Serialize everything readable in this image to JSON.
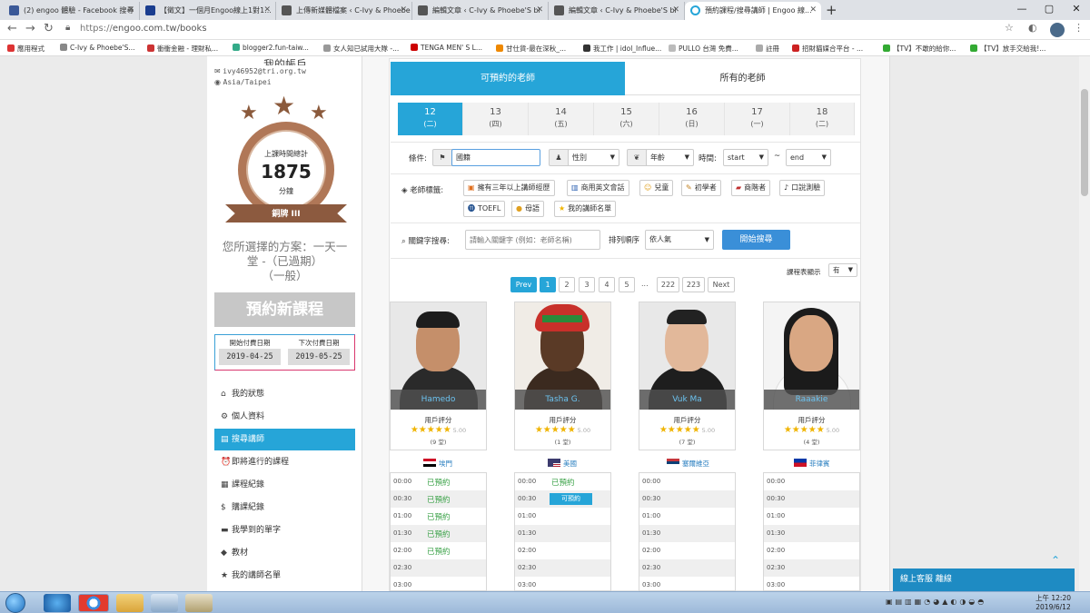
{
  "browser": {
    "tabs": [
      {
        "title": "(2) engoo 體驗 - Facebook 搜尋",
        "fav": "#3b5998"
      },
      {
        "title": "【徵文】一個月Engoo線上1對1...",
        "fav": "#1a3d8f"
      },
      {
        "title": "上傳新媒體檔案 ‹ C-Ivy & Phoebe",
        "fav": "#555"
      },
      {
        "title": "編輯文章 ‹ C-Ivy & Phoebe'S bl",
        "fav": "#555"
      },
      {
        "title": "編輯文章 ‹ C-Ivy & Phoebe'S bl",
        "fav": "#555"
      },
      {
        "title": "預約課程/搜尋講師 | Engoo 線...",
        "fav": "#26a5d8"
      }
    ],
    "new_tab": "+",
    "window_controls": [
      "—",
      "▢",
      "✕"
    ],
    "url_scheme": "https://",
    "url_rest": "engoo.com.tw/books",
    "bookmarks": [
      "應用程式",
      "C-Ivy & Phoebe'S...",
      "衝衝金融 - 理財私...",
      "blogger2.fun-taiw...",
      "女人知已試用大隊 -...",
      "TENGA MEN' S L...",
      "甘仕貨-最在深秋_...",
      "我工作 | idol_Influe...",
      "PULLO 台灣 免費...",
      "註冊",
      "招財貓媒合平台 - ...",
      "【TV】不敢的給你...",
      "【TV】放手交給我!..."
    ]
  },
  "sidebar": {
    "account_title": "我的帳戶",
    "email": "ivy46952@tri.org.tw",
    "timezone": "Asia/Taipei",
    "badge": {
      "title": "上課時間總計",
      "minutes": "1875",
      "unit": "分鐘",
      "rank": "銅牌 III"
    },
    "plan": [
      "您所選擇的方案：一天一",
      "堂 -（已過期）",
      "（一般）"
    ],
    "book_button": "預約新課程",
    "payment": {
      "start_label": "開始付費日期",
      "start_date": "2019-04-25",
      "next_label": "下次付費日期",
      "next_date": "2019-05-25"
    },
    "menu": [
      {
        "icon": "home-icon",
        "glyph": "⌂",
        "label": "我的狀態"
      },
      {
        "icon": "gear-icon",
        "glyph": "⚙",
        "label": "個人資料"
      },
      {
        "icon": "book-icon",
        "glyph": "▤",
        "label": "搜尋講師"
      },
      {
        "icon": "clock-icon",
        "glyph": "⏰",
        "label": "即將進行的課程"
      },
      {
        "icon": "list-icon",
        "glyph": "▦",
        "label": "課程紀錄"
      },
      {
        "icon": "dollar-icon",
        "glyph": "$",
        "label": "購課紀錄"
      },
      {
        "icon": "folder-icon",
        "glyph": "▬",
        "label": "我學到的單字"
      },
      {
        "icon": "tag-icon",
        "glyph": "◆",
        "label": "教材"
      },
      {
        "icon": "star-icon",
        "glyph": "★",
        "label": "我的講師名單"
      }
    ]
  },
  "main": {
    "tab_available": "可預約的老師",
    "tab_all": "所有的老師",
    "dates": [
      {
        "day": "12",
        "weekday": "(二)"
      },
      {
        "day": "13",
        "weekday": "(四)"
      },
      {
        "day": "14",
        "weekday": "(五)"
      },
      {
        "day": "15",
        "weekday": "(六)"
      },
      {
        "day": "16",
        "weekday": "(日)"
      },
      {
        "day": "17",
        "weekday": "(一)"
      },
      {
        "day": "18",
        "weekday": "(二)"
      }
    ],
    "filters": {
      "condition_label": "條件:",
      "nationality_value": "國籍",
      "gender_value": "性別",
      "age_value": "年齡",
      "time_label": "時間:",
      "time_start": "start",
      "time_sep": "~",
      "time_end": "end",
      "tags_label": "老師標籤:",
      "tags": [
        {
          "glyph": "▣",
          "label": "擁有三年以上講師經歷"
        },
        {
          "glyph": "▥",
          "label": "商用英文會話"
        },
        {
          "glyph": "☺",
          "label": "兒童"
        },
        {
          "glyph": "✎",
          "label": "初學者"
        },
        {
          "glyph": "▰",
          "label": "商階者"
        },
        {
          "glyph": "♪",
          "label": "口說測驗"
        },
        {
          "glyph": "⓫",
          "label": "TOEFL"
        },
        {
          "glyph": "●",
          "label": "母語"
        },
        {
          "glyph": "★",
          "label": "我的講師名單"
        }
      ],
      "keyword_label": "關鍵字搜尋:",
      "keyword_placeholder": "請輸入關鍵字 (例如：老師名稱)",
      "sort_label": "排列順序",
      "sort_value": "依人氣",
      "search_button": "開始搜尋"
    },
    "schedule_toggle_label": "課程表顯示",
    "schedule_toggle_value": "有",
    "pagination": [
      "Prev",
      "1",
      "2",
      "3",
      "4",
      "5",
      "...",
      "222",
      "223",
      "Next"
    ],
    "teachers": [
      {
        "name": "Hamedo",
        "rating_label": "用戶評分",
        "stars": "★★★★★",
        "score": "5.00",
        "count": "(9 堂)",
        "country": "埃門",
        "slots": [
          {
            "t": "00:00",
            "s": "已預約"
          },
          {
            "t": "00:30",
            "s": "已預約"
          },
          {
            "t": "01:00",
            "s": "已預約"
          },
          {
            "t": "01:30",
            "s": "已預約"
          },
          {
            "t": "02:00",
            "s": "已預約"
          },
          {
            "t": "02:30",
            "s": ""
          },
          {
            "t": "03:00",
            "s": ""
          }
        ]
      },
      {
        "name": "Tasha G.",
        "rating_label": "用戶評分",
        "stars": "★★★★★",
        "score": "5.00",
        "count": "(1 堂)",
        "country": "美國",
        "slots": [
          {
            "t": "00:00",
            "s": "已預約"
          },
          {
            "t": "00:30",
            "s": "可預約"
          },
          {
            "t": "01:00",
            "s": ""
          },
          {
            "t": "01:30",
            "s": ""
          },
          {
            "t": "02:00",
            "s": ""
          },
          {
            "t": "02:30",
            "s": ""
          },
          {
            "t": "03:00",
            "s": ""
          }
        ]
      },
      {
        "name": "Vuk Ma",
        "rating_label": "用戶評分",
        "stars": "★★★★★",
        "score": "5.00",
        "count": "(7 堂)",
        "country": "塞爾維亞",
        "slots": [
          {
            "t": "00:00",
            "s": ""
          },
          {
            "t": "00:30",
            "s": ""
          },
          {
            "t": "01:00",
            "s": ""
          },
          {
            "t": "01:30",
            "s": ""
          },
          {
            "t": "02:00",
            "s": ""
          },
          {
            "t": "02:30",
            "s": ""
          },
          {
            "t": "03:00",
            "s": ""
          }
        ]
      },
      {
        "name": "Raaakie",
        "rating_label": "用戶評分",
        "stars": "★★★★★",
        "score": "5.00",
        "count": "(4 堂)",
        "country": "菲律賓",
        "slots": [
          {
            "t": "00:00",
            "s": ""
          },
          {
            "t": "00:30",
            "s": ""
          },
          {
            "t": "01:00",
            "s": ""
          },
          {
            "t": "01:30",
            "s": ""
          },
          {
            "t": "02:00",
            "s": ""
          },
          {
            "t": "02:30",
            "s": ""
          },
          {
            "t": "03:00",
            "s": ""
          }
        ]
      }
    ]
  },
  "chat": {
    "label": "線上客服 離線",
    "up": "⌃"
  },
  "taskbar": {
    "time": "上午 12:20",
    "date": "2019/6/12"
  },
  "colors": {
    "accent": "#26a5d8",
    "badge_bronze": "#8c5a3f",
    "booked_green": "#3da34a",
    "star_gold": "#f0b400"
  }
}
